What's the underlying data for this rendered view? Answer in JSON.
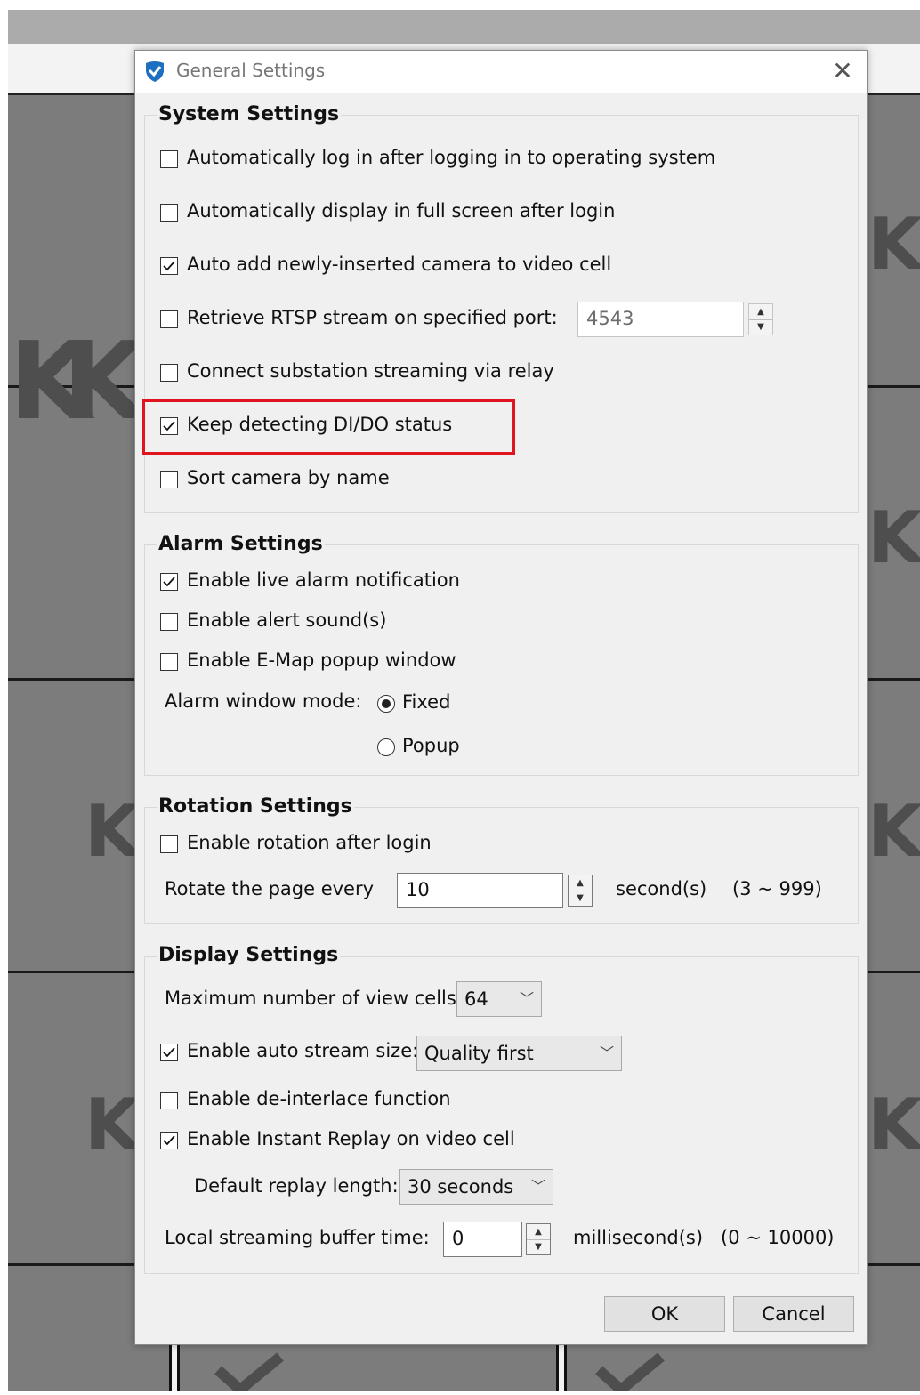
{
  "dialog": {
    "title": "General Settings",
    "close_glyph": "✕",
    "icon": "app-shield-icon"
  },
  "background": {
    "watermarks": [
      "K",
      "K",
      "K",
      "K",
      "K",
      "K",
      "K",
      "K"
    ]
  },
  "system_settings": {
    "title": "System Settings",
    "auto_login": {
      "label": "Automatically log in after logging in to operating system",
      "checked": false
    },
    "auto_fullscreen": {
      "label": "Automatically display in full screen after login",
      "checked": false
    },
    "auto_add_camera": {
      "label": "Auto add newly-inserted camera to video cell",
      "checked": true
    },
    "rtsp_port": {
      "label": "Retrieve RTSP stream on specified port:",
      "checked": false,
      "value": "4543"
    },
    "substation_relay": {
      "label": "Connect substation streaming via relay",
      "checked": false
    },
    "detect_dido": {
      "label": "Keep detecting DI/DO status",
      "checked": true,
      "highlight_color": "#e0141e"
    },
    "sort_camera": {
      "label": "Sort camera by name",
      "checked": false
    }
  },
  "alarm_settings": {
    "title": "Alarm Settings",
    "live_alarm": {
      "label": "Enable live alarm notification",
      "checked": true
    },
    "alert_sound": {
      "label": "Enable alert sound(s)",
      "checked": false
    },
    "emap_popup": {
      "label": "Enable E-Map popup window",
      "checked": false
    },
    "window_mode_label": "Alarm window mode:",
    "mode_fixed": {
      "label": "Fixed",
      "selected": true
    },
    "mode_popup": {
      "label": "Popup",
      "selected": false
    }
  },
  "rotation_settings": {
    "title": "Rotation Settings",
    "enable_rotation": {
      "label": "Enable rotation after login",
      "checked": false
    },
    "rotate_label": "Rotate the page every",
    "rotate_value": "10",
    "rotate_unit": "second(s)",
    "rotate_range": "(3 ~ 999)"
  },
  "display_settings": {
    "title": "Display Settings",
    "max_cells_label": "Maximum number of view cells",
    "max_cells_value": "64",
    "auto_stream": {
      "label": "Enable auto stream size:",
      "checked": true,
      "value": "Quality first"
    },
    "deinterlace": {
      "label": "Enable de-interlace function",
      "checked": false
    },
    "instant_replay": {
      "label": "Enable Instant Replay on video cell",
      "checked": true
    },
    "replay_length_label": "Default replay length:",
    "replay_length_value": "30 seconds",
    "buffer_label": "Local streaming buffer time:",
    "buffer_value": "0",
    "buffer_unit": "millisecond(s)",
    "buffer_range": "(0 ~ 10000)"
  },
  "buttons": {
    "ok": "OK",
    "cancel": "Cancel"
  },
  "colors": {
    "dialog_bg": "#f0f0f0",
    "highlight": "#e0141e",
    "icon_blue": "#1e6fc0"
  }
}
